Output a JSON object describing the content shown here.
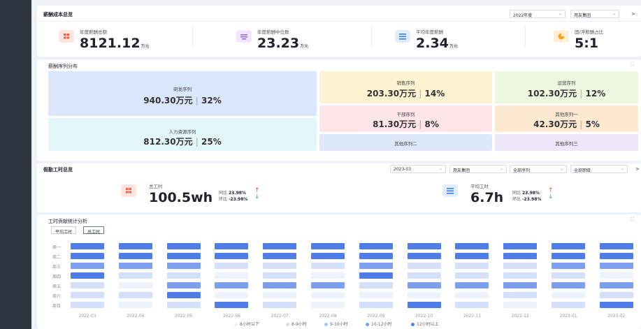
{
  "overview": {
    "title": "薪酬成本总览",
    "filter_year": "2022年度",
    "filter_group": "用友集团",
    "kpis": [
      {
        "label": "年度薪酬总额",
        "value": "8121.12",
        "unit": "万元",
        "icon": "table-icon",
        "color": "#f05a4f"
      },
      {
        "label": "年度薪酬中位数",
        "value": "23.23",
        "unit": "万元",
        "icon": "median-icon",
        "color": "#a06ae8"
      },
      {
        "label": "平均年度薪酬",
        "value": "2.34",
        "unit": "万元",
        "icon": "average-icon",
        "color": "#3f7ce8"
      },
      {
        "label": "固/浮薪酬占比",
        "value": "5:1",
        "unit": "",
        "icon": "pie-icon",
        "color": "#f5a623"
      }
    ]
  },
  "distribution": {
    "title": "薪酬序列分布",
    "tiles": [
      {
        "name": "研发序列",
        "value": "940.30万元",
        "pct": "32%",
        "color": "#dbe7fc"
      },
      {
        "name": "人力资源序列",
        "value": "812.30万元",
        "pct": "25%",
        "color": "#e3f6fa"
      },
      {
        "name": "销售序列",
        "value": "203.30万元",
        "pct": "14%",
        "color": "#fdf3d2"
      },
      {
        "name": "运营序列",
        "value": "102.30万元",
        "pct": "12%",
        "color": "#eef8e0"
      },
      {
        "name": "干部序列",
        "value": "81.30万元",
        "pct": "8%",
        "color": "#fde5e8"
      },
      {
        "name": "其他序列一",
        "value": "42.30万元",
        "pct": "5%",
        "color": "#fde9d2"
      },
      {
        "name": "其他序列二",
        "color": "#dde9fb"
      },
      {
        "name": "其他序列三",
        "color": "#ece7f9"
      }
    ]
  },
  "attendance": {
    "title": "假勤工时总览",
    "filter_month": "2023-03",
    "filter_group": "用友集团",
    "filter_seq": "全部序列",
    "filter_level": "全部职级",
    "items": [
      {
        "label": "总工时",
        "value": "100.5wh",
        "yoy_label": "同比",
        "yoy": "23.98%",
        "mom_label": "环比",
        "mom": "-23.98%"
      },
      {
        "label": "平均工时",
        "value": "6.7h",
        "yoy_label": "同比",
        "yoy": "23.98%",
        "mom_label": "环比",
        "mom": "-23.98%"
      }
    ]
  },
  "contribution": {
    "title": "工时贡献统计分析",
    "tabs": [
      "平均工时",
      "总工时"
    ],
    "active_tab": "总工时"
  },
  "chart_data": {
    "type": "heatmap",
    "y_categories": [
      "周一",
      "周二",
      "周三",
      "周四",
      "周五",
      "周六",
      "周日"
    ],
    "x_categories": [
      "2022-03",
      "2022-04",
      "2022-05",
      "2022-06",
      "2022-07",
      "2022-08",
      "2022-09",
      "2022-10",
      "2022-11",
      "2022-12",
      "2023-01",
      "2023-02"
    ],
    "legend": [
      "8小时以下",
      "8-9小时",
      "9-10小时",
      "10-12小时",
      "12小时以上"
    ],
    "legend_colors": [
      "#eef2fc",
      "#d4e0fa",
      "#a9c1f5",
      "#7c9ff0",
      "#4f7de8"
    ],
    "values": [
      [
        4,
        4,
        4,
        4,
        4,
        4,
        4,
        4,
        4,
        4,
        4,
        4
      ],
      [
        4,
        4,
        4,
        4,
        4,
        4,
        4,
        4,
        4,
        4,
        4,
        4
      ],
      [
        3,
        3,
        3,
        1,
        1,
        1,
        3,
        1,
        1,
        1,
        3,
        3
      ],
      [
        4,
        1,
        1,
        0,
        1,
        0,
        4,
        1,
        1,
        1,
        1,
        0
      ],
      [
        1,
        0,
        3,
        3,
        3,
        3,
        1,
        3,
        3,
        3,
        3,
        3
      ],
      [
        1,
        1,
        4,
        0,
        0,
        0,
        0,
        0,
        0,
        1,
        0,
        1
      ],
      [
        1,
        0,
        1,
        4,
        1,
        0,
        1,
        4,
        1,
        0,
        1,
        4
      ]
    ]
  }
}
